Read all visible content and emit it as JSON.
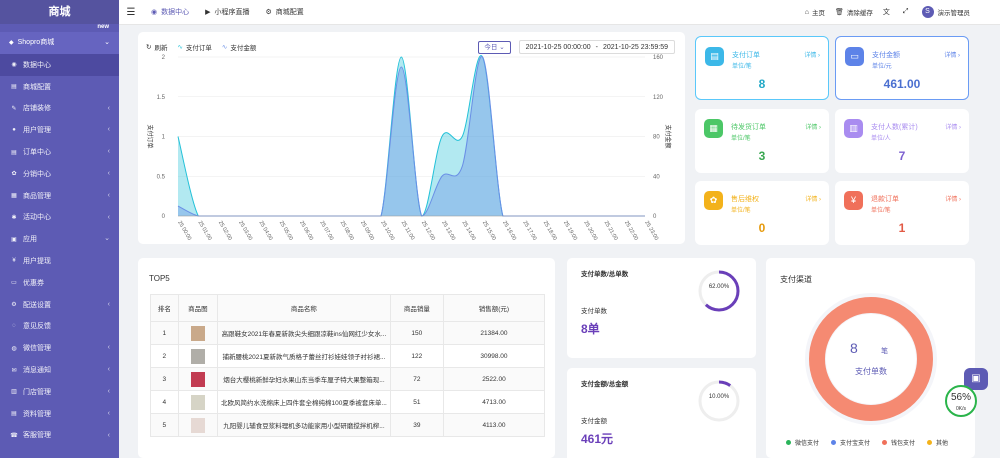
{
  "sidebar": {
    "logo": "商城",
    "cut_item": "",
    "cut_badge": "new",
    "group_label": "Shopro商城",
    "items": [
      {
        "label": "数据中心",
        "icon": "◉",
        "arrow": "",
        "active": true
      },
      {
        "label": "商城配置",
        "icon": "▤",
        "arrow": ""
      },
      {
        "label": "店铺装修",
        "icon": "✎",
        "arrow": "‹"
      },
      {
        "label": "用户管理",
        "icon": "●",
        "arrow": "‹"
      },
      {
        "label": "订单中心",
        "icon": "▤",
        "arrow": "‹"
      },
      {
        "label": "分销中心",
        "icon": "✿",
        "arrow": "‹"
      },
      {
        "label": "商品管理",
        "icon": "▦",
        "arrow": "‹"
      },
      {
        "label": "活动中心",
        "icon": "✱",
        "arrow": "‹"
      },
      {
        "label": "应用",
        "icon": "▣",
        "arrow": "⌄"
      },
      {
        "label": "用户提现",
        "icon": "¥",
        "arrow": ""
      },
      {
        "label": "优惠券",
        "icon": "▭",
        "arrow": ""
      },
      {
        "label": "配送设置",
        "icon": "⚙",
        "arrow": "‹"
      },
      {
        "label": "意见反馈",
        "icon": "◌",
        "arrow": ""
      },
      {
        "label": "微信管理",
        "icon": "◍",
        "arrow": "‹"
      },
      {
        "label": "消息通知",
        "icon": "✉",
        "arrow": "‹"
      },
      {
        "label": "门店管理",
        "icon": "▥",
        "arrow": "‹"
      },
      {
        "label": "资料管理",
        "icon": "▤",
        "arrow": "‹"
      },
      {
        "label": "客服管理",
        "icon": "☎",
        "arrow": "‹"
      }
    ]
  },
  "topbar": {
    "hamburger_icon": "☰",
    "tabs": [
      {
        "label": "数据中心",
        "icon": "◉"
      },
      {
        "label": "小程序直播",
        "icon": "▶"
      },
      {
        "label": "商城配置",
        "icon": "⚙"
      }
    ],
    "home": "主页",
    "clear_cache": "清除缓存",
    "user": "演示管理员",
    "user_avatar": "S"
  },
  "chart_toolbar": {
    "refresh": "刷新",
    "legend_orders": "支付订单",
    "legend_amount": "支付金额",
    "today": "今日",
    "date_start": "2021-10-25 00:00:00",
    "date_sep": "-",
    "date_end": "2021-10-25 23:59:59"
  },
  "chart_data": {
    "type": "area",
    "x": [
      "23:00:00",
      "00:00:00",
      "01:00:00",
      "02:00:00",
      "03:00:00",
      "04:00:00",
      "05:00:00",
      "06:00:00",
      "07:00:00",
      "08:00:00",
      "09:00:00",
      "10:00:00",
      "11:00:00",
      "12:00:00",
      "13:00:00",
      "14:00:00",
      "15:00:00",
      "16:00:00",
      "17:00:00",
      "18:00:00",
      "19:00:00",
      "20:00:00",
      "21:00:00",
      "22:00:00"
    ],
    "x_labels": [
      "25 00:00",
      "25 01:00",
      "25 02:00",
      "25 03:00",
      "25 04:00",
      "25 05:00",
      "25 06:00",
      "25 07:00",
      "25 08:00",
      "25 09:00",
      "25 10:00",
      "25 11:00",
      "25 12:00",
      "25 13:00",
      "25 14:00",
      "25 15:00",
      "25 16:00",
      "25 17:00",
      "25 18:00",
      "25 19:00",
      "25 20:00",
      "25 21:00",
      "25 22:00",
      "25 23:00"
    ],
    "series": [
      {
        "name": "支付订单",
        "axis": "left",
        "values": [
          1,
          0,
          0,
          0,
          0,
          0,
          0,
          0,
          0,
          0,
          0,
          2,
          0,
          1,
          1,
          2,
          0,
          0,
          0,
          0,
          0,
          0,
          0,
          0
        ]
      },
      {
        "name": "支付金额",
        "axis": "right",
        "values": [
          10,
          0,
          0,
          0,
          0,
          0,
          0,
          0,
          0,
          0,
          0,
          150,
          0,
          40,
          50,
          160,
          0,
          0,
          0,
          0,
          0,
          0,
          0,
          0
        ]
      }
    ],
    "ylabel_left": "支付订单",
    "ylabel_right": "支付金额",
    "ylim_left": [
      0,
      2
    ],
    "ylim_right": [
      0,
      160
    ],
    "yticks_left": [
      "0",
      "0.5",
      "1",
      "1.5",
      "2"
    ],
    "yticks_right": [
      "0",
      "40",
      "80",
      "120",
      "160"
    ],
    "grid": true,
    "colors": {
      "orders": "#23c1d8",
      "amount": "#6a8fe6"
    }
  },
  "stats": [
    {
      "title": "支付订单",
      "unit": "单位/笔",
      "detail": "详情",
      "value": "8",
      "color": "#3cb8e8",
      "value_color": "#23a9c7"
    },
    {
      "title": "支付金额",
      "unit": "单位/元",
      "detail": "详情",
      "value": "461.00",
      "color": "#5d83e8",
      "value_color": "#4a6fd0"
    },
    {
      "title": "待发货订单",
      "unit": "单位/笔",
      "detail": "详情",
      "value": "3",
      "color": "#4cc767",
      "value_color": "#3aa852"
    },
    {
      "title": "支付人数(累计)",
      "unit": "单位/人",
      "detail": "详情",
      "value": "7",
      "color": "#a98cf0",
      "value_color": "#7c5fd0"
    },
    {
      "title": "售后维权",
      "unit": "单位/笔",
      "detail": "详情",
      "value": "0",
      "color": "#f3b21b",
      "value_color": "#e69a0c"
    },
    {
      "title": "退款订单",
      "unit": "单位/笔",
      "detail": "详情",
      "value": "1",
      "color": "#f0705a",
      "value_color": "#e25a45"
    }
  ],
  "top5": {
    "title": "TOP5",
    "headers": [
      "排名",
      "商品图",
      "商品名称",
      "商品销量",
      "销售额(元)"
    ],
    "rows": [
      {
        "rank": "1",
        "name": "高跟鞋女2021年春夏新款尖头细跟凉鞋ins仙网红少女水...",
        "sales": "150",
        "amount": "21384.00",
        "thumb": "#c9a98a"
      },
      {
        "rank": "2",
        "name": "捕新腰桃2021夏新款气质格子蕾丝打衫娃娃领子衬衫裙...",
        "sales": "122",
        "amount": "30998.00",
        "thumb": "#b0aea8"
      },
      {
        "rank": "3",
        "name": "烟台大樱桃新鲜孕妇水果山东当季车厘子特大果整箱现...",
        "sales": "72",
        "amount": "2522.00",
        "thumb": "#c23c52"
      },
      {
        "rank": "4",
        "name": "北欧风简约水洗棉床上四件套全棉纯棉100夏季被套床单...",
        "sales": "51",
        "amount": "4713.00",
        "thumb": "#d6d4c6"
      },
      {
        "rank": "5",
        "name": "九阳婴儿辅食豆浆料理机多功能家用小型研磨搅拌机榨...",
        "sales": "39",
        "amount": "4113.00",
        "thumb": "#e6d9d4"
      }
    ]
  },
  "ratio_orders": {
    "title": "支付单数/总单数",
    "label": "支付单数",
    "value": "8单",
    "pct": "62.00%",
    "ratio": 0.62
  },
  "ratio_amount": {
    "title": "支付金额/总金额",
    "label": "支付金额",
    "value": "461元",
    "pct": "10.00%",
    "ratio": 0.1
  },
  "channel": {
    "title": "支付渠道",
    "number": "8",
    "unit": "笔",
    "label": "支付单数",
    "legend": [
      {
        "label": "微信支付",
        "color": "#2ab45a"
      },
      {
        "label": "支付宝支付",
        "color": "#5d83e8"
      },
      {
        "label": "钱包支付",
        "color": "#f0705a"
      },
      {
        "label": "其他",
        "color": "#f3b21b"
      }
    ]
  },
  "float": {
    "chat_icon": "▣",
    "speed_pct": "56%",
    "speed_rate": "0K/s"
  }
}
